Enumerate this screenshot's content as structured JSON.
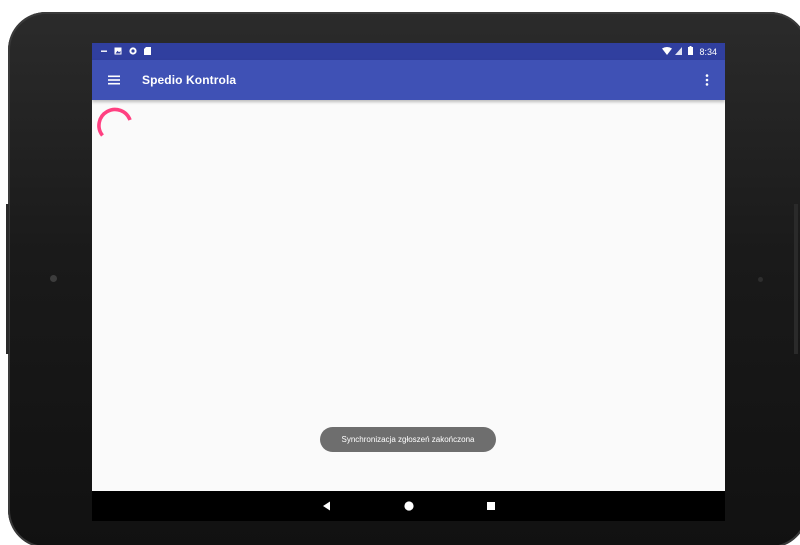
{
  "colors": {
    "status_bar": "#303f9f",
    "app_bar": "#3f51b5",
    "accent_spinner": "#ff4081",
    "screen_background": "#fafafa",
    "toast_background": "#6e6e6e",
    "device_frame": "#1a1a1a"
  },
  "status_bar": {
    "left_icons": [
      "minus-icon",
      "image-icon",
      "circle-dot-icon",
      "sd-card-icon"
    ],
    "right_icons": [
      "wifi-icon",
      "signal-icon",
      "battery-icon"
    ],
    "time": "8:34"
  },
  "app_bar": {
    "title": "Spedio Kontrola",
    "menu_icon": "hamburger-menu-icon",
    "overflow_icon": "more-vertical-icon"
  },
  "content": {
    "loading_indicator": "progress-spinner-icon"
  },
  "toast": {
    "message": "Synchronizacja zgłoszeń zakończona"
  },
  "nav_bar": {
    "buttons": [
      "back-icon",
      "home-icon",
      "recents-icon"
    ]
  }
}
